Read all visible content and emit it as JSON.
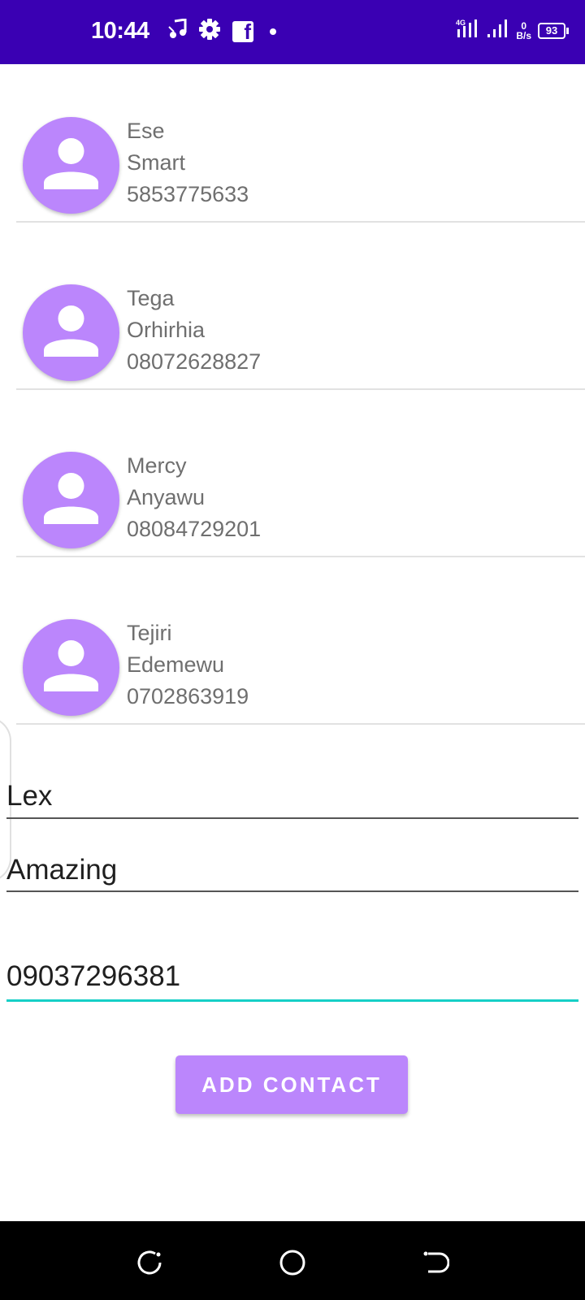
{
  "status_bar": {
    "time": "10:44",
    "left_icons": [
      "music-icon",
      "settings-gear-icon",
      "facebook-icon",
      "dot-icon"
    ],
    "network_type": "4G",
    "data_rate_value": "0",
    "data_rate_unit": "B/s",
    "battery_level": "93",
    "background_color": "#3a00b3"
  },
  "contacts": [
    {
      "first_name": "Ese",
      "last_name": "Smart",
      "phone": "5853775633"
    },
    {
      "first_name": "Tega",
      "last_name": "Orhirhia",
      "phone": "08072628827"
    },
    {
      "first_name": "Mercy",
      "last_name": "Anyawu",
      "phone": "08084729201"
    },
    {
      "first_name": "Tejiri",
      "last_name": "Edemewu",
      "phone": "0702863919"
    }
  ],
  "form": {
    "first_name_value": "Lex",
    "last_name_value": "Amazing",
    "phone_value": "09037296381",
    "add_button_label": "ADD CONTACT"
  },
  "colors": {
    "accent": "#bb86fc",
    "active_field_underline": "#16cfc6"
  },
  "nav_bar": {
    "icons": [
      "recents-icon",
      "home-icon",
      "back-icon"
    ]
  }
}
